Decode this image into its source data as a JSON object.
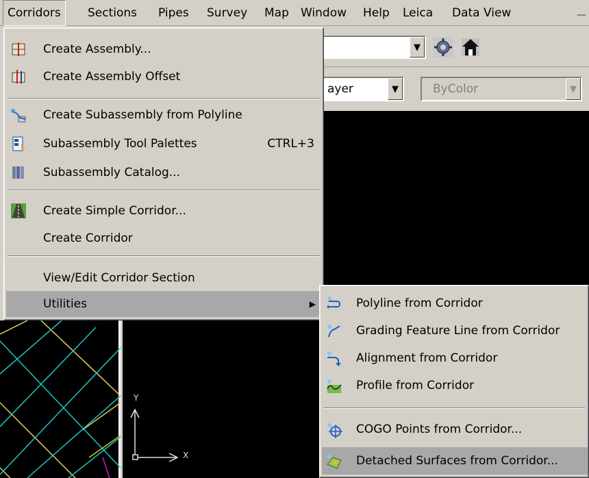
{
  "menubar": {
    "items": [
      {
        "label": "Corridors",
        "active": true
      },
      {
        "label": "Sections"
      },
      {
        "label": "Pipes"
      },
      {
        "label": "Survey"
      },
      {
        "label": "Map"
      },
      {
        "label": "Window"
      },
      {
        "label": "Help"
      },
      {
        "label": "Leica"
      },
      {
        "label": "Data View"
      }
    ],
    "corner": "—"
  },
  "toolbar": {
    "layer_combo_text": "ayer",
    "color_combo_text": "ByColor"
  },
  "corridors_menu": {
    "items": [
      {
        "label": "Create Assembly...",
        "icon": "create-assembly-icon"
      },
      {
        "label": "Create Assembly Offset",
        "icon": "assembly-offset-icon"
      },
      {
        "label": "Create Subassembly from Polyline",
        "icon": "subassembly-polyline-icon"
      },
      {
        "label": "Subassembly Tool Palettes",
        "shortcut": "CTRL+3",
        "icon": "tool-palettes-icon"
      },
      {
        "label": "Subassembly Catalog...",
        "icon": "catalog-icon"
      },
      {
        "label": "Create Simple Corridor...",
        "icon": "simple-corridor-icon"
      },
      {
        "label": "Create Corridor"
      },
      {
        "label": "View/Edit Corridor Section"
      },
      {
        "label": "Utilities",
        "has_submenu": true
      }
    ]
  },
  "utilities_submenu": {
    "items": [
      {
        "label": "Polyline from Corridor",
        "icon": "polyline-from-corridor-icon"
      },
      {
        "label": "Grading Feature Line from Corridor",
        "icon": "feature-line-icon"
      },
      {
        "label": "Alignment from Corridor",
        "icon": "alignment-icon"
      },
      {
        "label": "Profile from Corridor",
        "icon": "profile-icon"
      },
      {
        "label": "COGO Points from Corridor...",
        "icon": "cogo-points-icon"
      },
      {
        "label": "Detached Surfaces from Corridor...",
        "icon": "detached-surfaces-icon"
      }
    ]
  },
  "ucs": {
    "y_label": "Y",
    "x_label": "X"
  },
  "colors": {
    "menu_bg": "#d4d0c8",
    "highlight": "#a8a8a8",
    "canvas": "#000000"
  }
}
